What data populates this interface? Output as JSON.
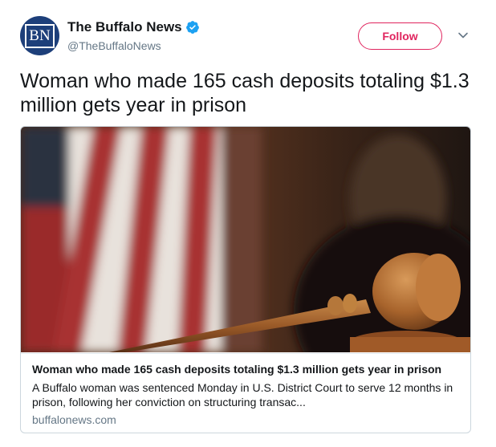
{
  "account": {
    "avatar_text": "BN",
    "name": "The Buffalo News",
    "handle": "@TheBuffaloNews",
    "verified": true
  },
  "actions": {
    "follow_label": "Follow",
    "menu_icon": "chevron-down-icon"
  },
  "tweet": {
    "text": "Woman who made 165 cash deposits totaling $1.3 million gets year in prison"
  },
  "card": {
    "image_desc_icon": "gavel-flag-photo",
    "title": "Woman who made 165 cash deposits totaling $1.3 million gets year in prison",
    "description": "A Buffalo woman was sentenced Monday in U.S. District Court to serve 12 months in prison, following her conviction on structuring transac...",
    "domain": "buffalonews.com"
  },
  "colors": {
    "follow_accent": "#e0245e",
    "verified_blue": "#1da1f2",
    "avatar_bg": "#1d3f7a",
    "muted_text": "#657786"
  }
}
